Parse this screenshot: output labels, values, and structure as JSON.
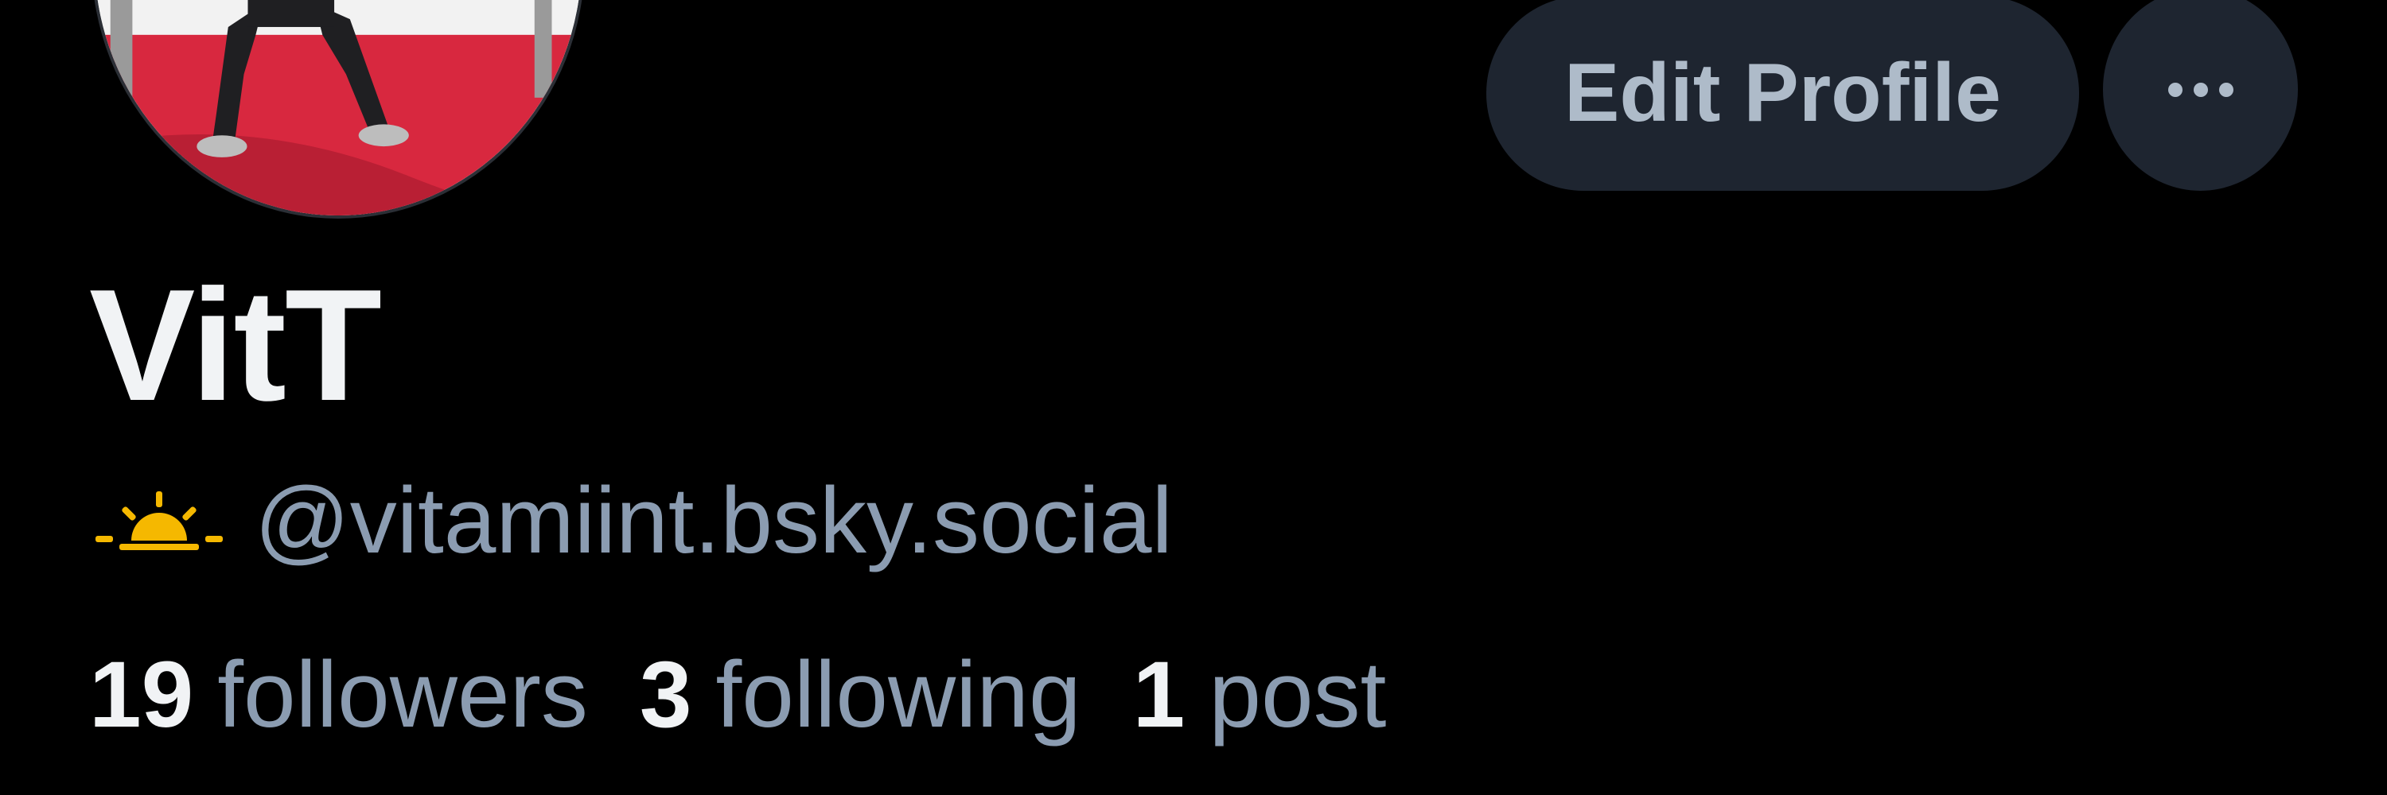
{
  "profile": {
    "display_name": "VitT",
    "handle": "@vitamiint.bsky.social",
    "status_icon": "sunrise-icon",
    "avatar_icon": "profile-avatar"
  },
  "actions": {
    "edit_label": "Edit Profile",
    "more_icon": "ellipsis-icon"
  },
  "stats": {
    "followers_count": "19",
    "followers_label": "followers",
    "following_count": "3",
    "following_label": "following",
    "posts_count": "1",
    "posts_label": "post"
  },
  "colors": {
    "background": "#000000",
    "button_bg": "#1e2530",
    "muted_text": "#8b9cb1",
    "primary_text": "#f1f3f5",
    "accent_sun": "#f5b800"
  }
}
